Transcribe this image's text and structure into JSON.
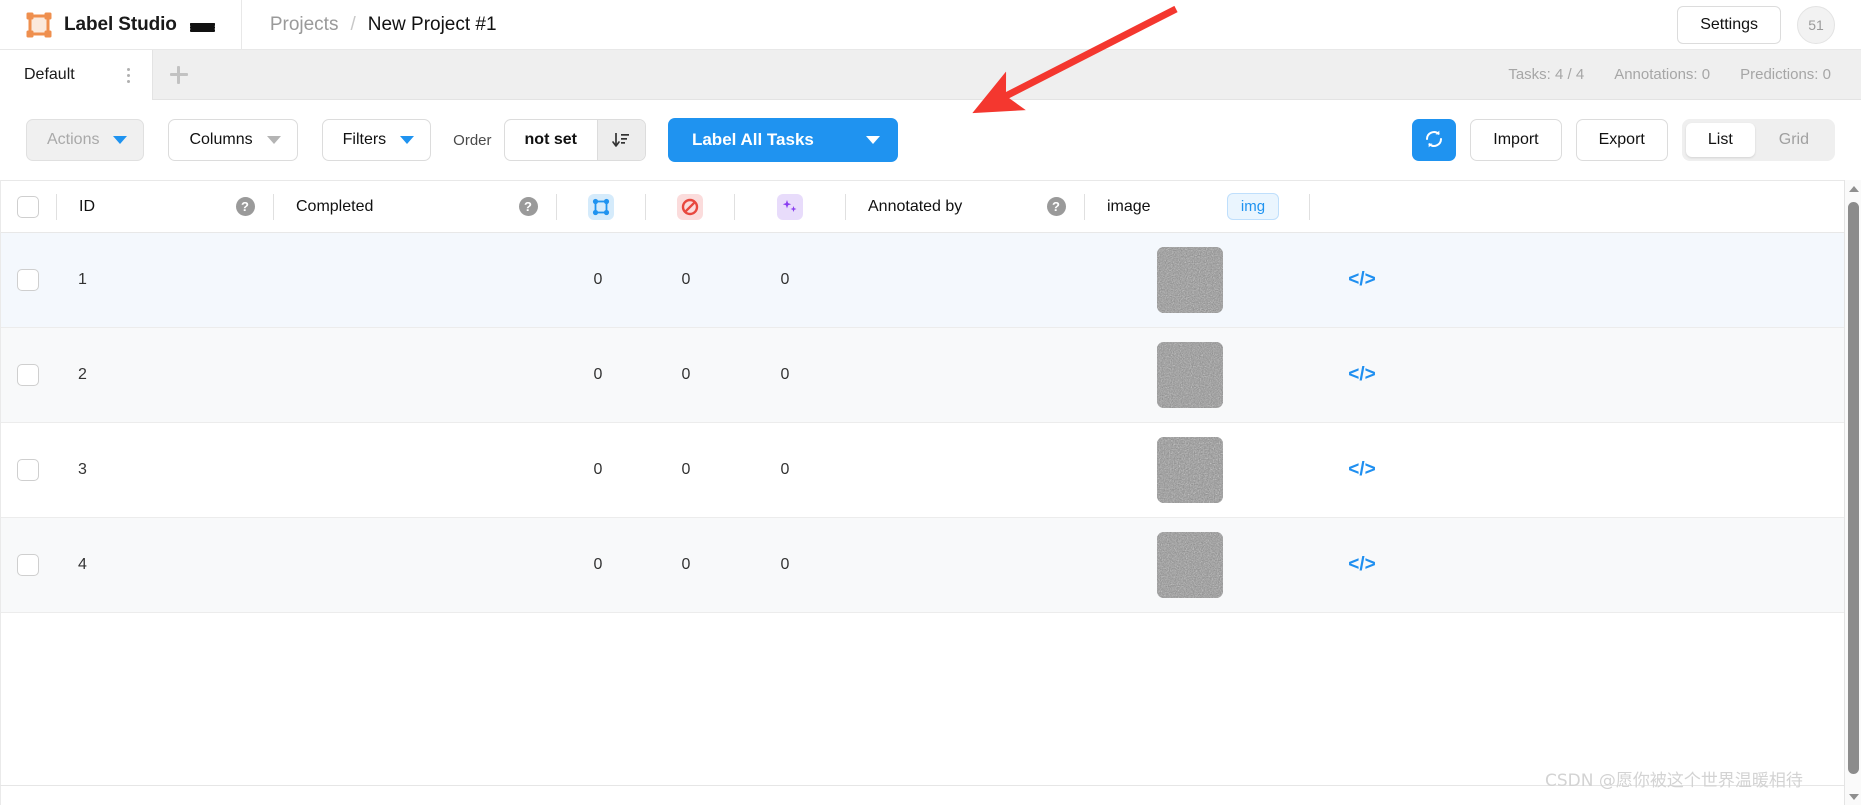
{
  "header": {
    "brand": "Label Studio",
    "logo_icon": "label-studio-logo",
    "menu_icon": "hamburger-menu-icon",
    "breadcrumb": {
      "parent": "Projects",
      "separator": "/",
      "current": "New Project #1"
    },
    "settings_label": "Settings",
    "avatar_initials": "51"
  },
  "tabbar": {
    "tabs": [
      {
        "label": "Default",
        "active": true
      }
    ],
    "tab_menu_icon": "kebab-menu-icon",
    "add_tab_icon": "plus-icon",
    "stats": [
      {
        "label": "Tasks: 4 / 4"
      },
      {
        "label": "Annotations: 0"
      },
      {
        "label": "Predictions: 0"
      }
    ]
  },
  "toolbar": {
    "actions_label": "Actions",
    "columns_label": "Columns",
    "filters_label": "Filters",
    "order_label": "Order",
    "order_value": "not set",
    "sort_icon": "sort-descending-icon",
    "label_all_tasks": "Label All Tasks",
    "refresh_icon": "refresh-icon",
    "import_label": "Import",
    "export_label": "Export",
    "view_list": "List",
    "view_grid": "Grid",
    "active_view": "List"
  },
  "table": {
    "columns": [
      {
        "key": "select",
        "label": "",
        "icon": "checkbox-icon"
      },
      {
        "key": "id",
        "label": "ID",
        "help": "?"
      },
      {
        "key": "completed",
        "label": "Completed",
        "help": "?"
      },
      {
        "key": "annotations",
        "label": "",
        "icon": "annotations-icon"
      },
      {
        "key": "cancelled",
        "label": "",
        "icon": "cancelled-icon"
      },
      {
        "key": "predictions",
        "label": "",
        "icon": "predictions-icon"
      },
      {
        "key": "annotated_by",
        "label": "Annotated by",
        "help": "?"
      },
      {
        "key": "image",
        "label": "image",
        "tag": "img"
      },
      {
        "key": "code",
        "label": "",
        "icon": "code-icon"
      }
    ],
    "help_glyph": "?",
    "img_tag": "img",
    "code_glyph": "</>",
    "rows": [
      {
        "id": "1",
        "completed": "",
        "annotations": "0",
        "cancelled": "0",
        "predictions": "0",
        "annotated_by": "",
        "image": "noise-thumbnail"
      },
      {
        "id": "2",
        "completed": "",
        "annotations": "0",
        "cancelled": "0",
        "predictions": "0",
        "annotated_by": "",
        "image": "noise-thumbnail"
      },
      {
        "id": "3",
        "completed": "",
        "annotations": "0",
        "cancelled": "0",
        "predictions": "0",
        "annotated_by": "",
        "image": "noise-thumbnail"
      },
      {
        "id": "4",
        "completed": "",
        "annotations": "0",
        "cancelled": "0",
        "predictions": "0",
        "annotated_by": "",
        "image": "noise-thumbnail"
      }
    ]
  },
  "annotation": {
    "arrow_color": "#f4372f",
    "points_to": "label-all-tasks-button"
  },
  "watermark": {
    "text": "CSDN @愿你被这个世界温暖相待"
  },
  "colors": {
    "accent_blue": "#1f93f0",
    "logo_orange": "#f19a59",
    "row_highlight": "#f4f8fd",
    "row_stripe": "#f8f9fa",
    "arrow_red": "#f4372f"
  }
}
